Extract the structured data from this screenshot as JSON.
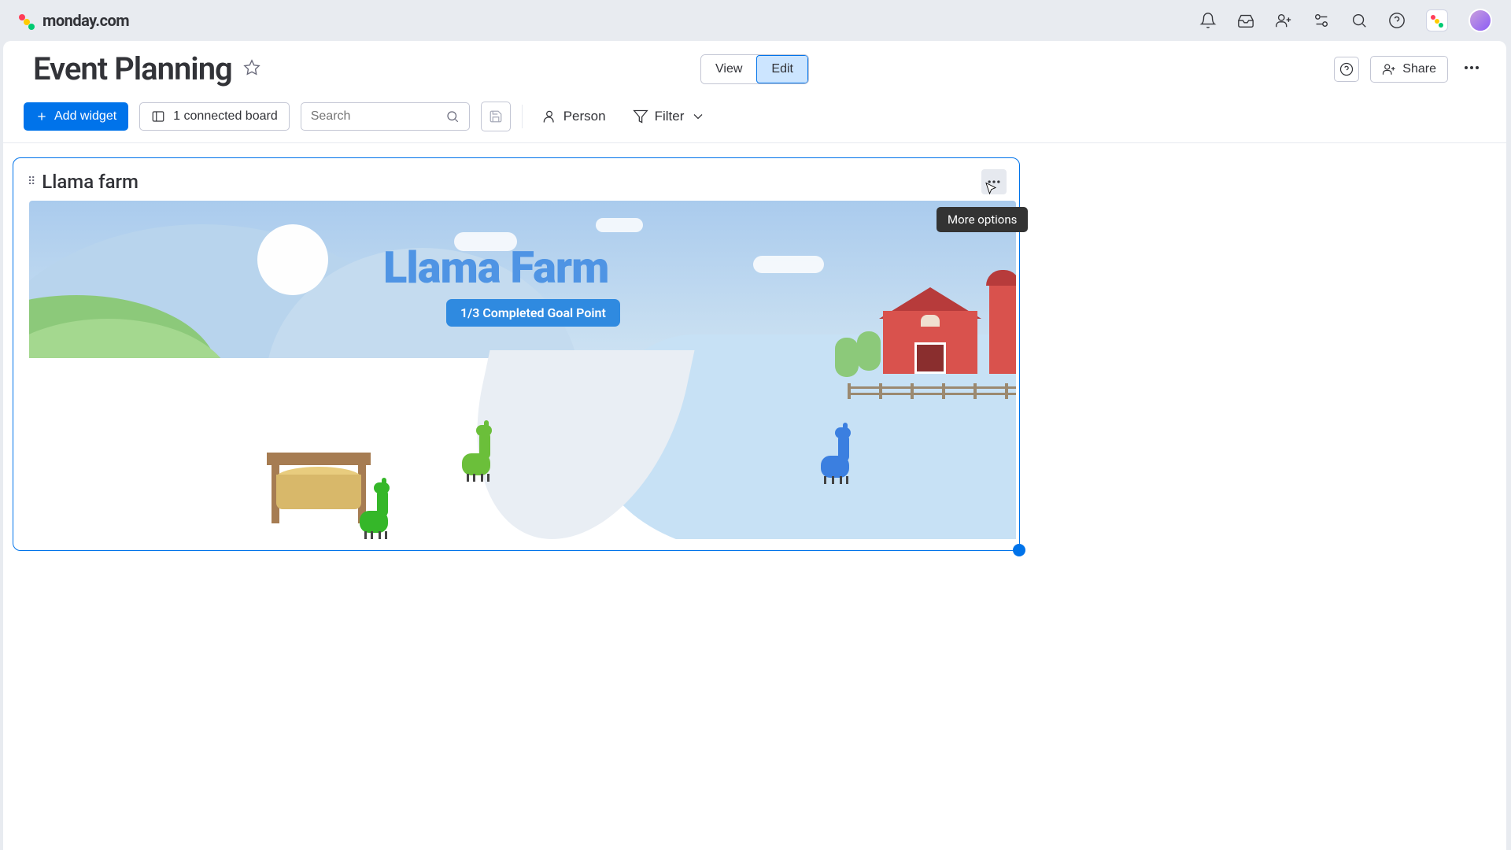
{
  "brand": {
    "name": "monday.com"
  },
  "page": {
    "title": "Event Planning"
  },
  "header": {
    "view_label": "View",
    "edit_label": "Edit",
    "share_label": "Share"
  },
  "toolbar": {
    "add_widget_label": "Add widget",
    "connected_boards_label": "1 connected board",
    "search_placeholder": "Search",
    "person_label": "Person",
    "filter_label": "Filter"
  },
  "widget": {
    "title": "Llama farm",
    "more_options_tooltip": "More options",
    "farm": {
      "heading": "Llama Farm",
      "goal_text": "1/3 Completed Goal Point"
    }
  }
}
